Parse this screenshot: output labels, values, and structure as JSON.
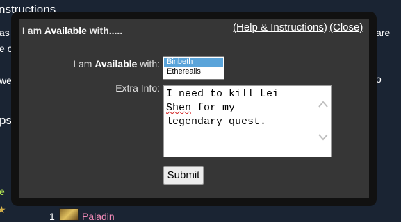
{
  "background": {
    "heading_fragment": "nstructions",
    "left_fragments": [
      "as",
      "e o",
      "we",
      "ps",
      "e"
    ],
    "right_fragments": [
      "are",
      "o"
    ],
    "list_number": "1",
    "class_name": "Paladin",
    "class_color": "#f58cba"
  },
  "modal": {
    "title_prefix": "I am ",
    "title_bold": "Available",
    "title_suffix": " with.....",
    "help_link": "(Help & Instructions)",
    "close_link": "(Close)",
    "available_label_prefix": "I am ",
    "available_label_bold": "Available",
    "available_label_suffix": " with:",
    "characters": [
      {
        "name": "Binbeth",
        "selected": true
      },
      {
        "name": "Etherealis",
        "selected": false
      }
    ],
    "extra_info_label": "Extra Info:",
    "extra_info_value_part1": "I need to kill Lei\n",
    "extra_info_value_misspelled": "Shen",
    "extra_info_value_part2": " for my\nlegendary quest.",
    "submit_label": "Submit"
  },
  "colors": {
    "page_background": "#1a2433",
    "modal_background": "#363636",
    "selected_option": "#5aa4da"
  }
}
